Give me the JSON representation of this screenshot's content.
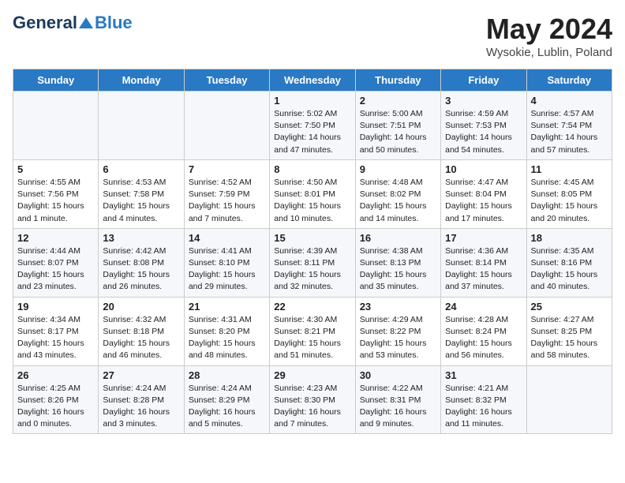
{
  "header": {
    "logo_general": "General",
    "logo_blue": "Blue",
    "month_year": "May 2024",
    "location": "Wysokie, Lublin, Poland"
  },
  "days_of_week": [
    "Sunday",
    "Monday",
    "Tuesday",
    "Wednesday",
    "Thursday",
    "Friday",
    "Saturday"
  ],
  "weeks": [
    [
      {
        "day": "",
        "info": ""
      },
      {
        "day": "",
        "info": ""
      },
      {
        "day": "",
        "info": ""
      },
      {
        "day": "1",
        "info": "Sunrise: 5:02 AM\nSunset: 7:50 PM\nDaylight: 14 hours\nand 47 minutes."
      },
      {
        "day": "2",
        "info": "Sunrise: 5:00 AM\nSunset: 7:51 PM\nDaylight: 14 hours\nand 50 minutes."
      },
      {
        "day": "3",
        "info": "Sunrise: 4:59 AM\nSunset: 7:53 PM\nDaylight: 14 hours\nand 54 minutes."
      },
      {
        "day": "4",
        "info": "Sunrise: 4:57 AM\nSunset: 7:54 PM\nDaylight: 14 hours\nand 57 minutes."
      }
    ],
    [
      {
        "day": "5",
        "info": "Sunrise: 4:55 AM\nSunset: 7:56 PM\nDaylight: 15 hours\nand 1 minute."
      },
      {
        "day": "6",
        "info": "Sunrise: 4:53 AM\nSunset: 7:58 PM\nDaylight: 15 hours\nand 4 minutes."
      },
      {
        "day": "7",
        "info": "Sunrise: 4:52 AM\nSunset: 7:59 PM\nDaylight: 15 hours\nand 7 minutes."
      },
      {
        "day": "8",
        "info": "Sunrise: 4:50 AM\nSunset: 8:01 PM\nDaylight: 15 hours\nand 10 minutes."
      },
      {
        "day": "9",
        "info": "Sunrise: 4:48 AM\nSunset: 8:02 PM\nDaylight: 15 hours\nand 14 minutes."
      },
      {
        "day": "10",
        "info": "Sunrise: 4:47 AM\nSunset: 8:04 PM\nDaylight: 15 hours\nand 17 minutes."
      },
      {
        "day": "11",
        "info": "Sunrise: 4:45 AM\nSunset: 8:05 PM\nDaylight: 15 hours\nand 20 minutes."
      }
    ],
    [
      {
        "day": "12",
        "info": "Sunrise: 4:44 AM\nSunset: 8:07 PM\nDaylight: 15 hours\nand 23 minutes."
      },
      {
        "day": "13",
        "info": "Sunrise: 4:42 AM\nSunset: 8:08 PM\nDaylight: 15 hours\nand 26 minutes."
      },
      {
        "day": "14",
        "info": "Sunrise: 4:41 AM\nSunset: 8:10 PM\nDaylight: 15 hours\nand 29 minutes."
      },
      {
        "day": "15",
        "info": "Sunrise: 4:39 AM\nSunset: 8:11 PM\nDaylight: 15 hours\nand 32 minutes."
      },
      {
        "day": "16",
        "info": "Sunrise: 4:38 AM\nSunset: 8:13 PM\nDaylight: 15 hours\nand 35 minutes."
      },
      {
        "day": "17",
        "info": "Sunrise: 4:36 AM\nSunset: 8:14 PM\nDaylight: 15 hours\nand 37 minutes."
      },
      {
        "day": "18",
        "info": "Sunrise: 4:35 AM\nSunset: 8:16 PM\nDaylight: 15 hours\nand 40 minutes."
      }
    ],
    [
      {
        "day": "19",
        "info": "Sunrise: 4:34 AM\nSunset: 8:17 PM\nDaylight: 15 hours\nand 43 minutes."
      },
      {
        "day": "20",
        "info": "Sunrise: 4:32 AM\nSunset: 8:18 PM\nDaylight: 15 hours\nand 46 minutes."
      },
      {
        "day": "21",
        "info": "Sunrise: 4:31 AM\nSunset: 8:20 PM\nDaylight: 15 hours\nand 48 minutes."
      },
      {
        "day": "22",
        "info": "Sunrise: 4:30 AM\nSunset: 8:21 PM\nDaylight: 15 hours\nand 51 minutes."
      },
      {
        "day": "23",
        "info": "Sunrise: 4:29 AM\nSunset: 8:22 PM\nDaylight: 15 hours\nand 53 minutes."
      },
      {
        "day": "24",
        "info": "Sunrise: 4:28 AM\nSunset: 8:24 PM\nDaylight: 15 hours\nand 56 minutes."
      },
      {
        "day": "25",
        "info": "Sunrise: 4:27 AM\nSunset: 8:25 PM\nDaylight: 15 hours\nand 58 minutes."
      }
    ],
    [
      {
        "day": "26",
        "info": "Sunrise: 4:25 AM\nSunset: 8:26 PM\nDaylight: 16 hours\nand 0 minutes."
      },
      {
        "day": "27",
        "info": "Sunrise: 4:24 AM\nSunset: 8:28 PM\nDaylight: 16 hours\nand 3 minutes."
      },
      {
        "day": "28",
        "info": "Sunrise: 4:24 AM\nSunset: 8:29 PM\nDaylight: 16 hours\nand 5 minutes."
      },
      {
        "day": "29",
        "info": "Sunrise: 4:23 AM\nSunset: 8:30 PM\nDaylight: 16 hours\nand 7 minutes."
      },
      {
        "day": "30",
        "info": "Sunrise: 4:22 AM\nSunset: 8:31 PM\nDaylight: 16 hours\nand 9 minutes."
      },
      {
        "day": "31",
        "info": "Sunrise: 4:21 AM\nSunset: 8:32 PM\nDaylight: 16 hours\nand 11 minutes."
      },
      {
        "day": "",
        "info": ""
      }
    ]
  ]
}
